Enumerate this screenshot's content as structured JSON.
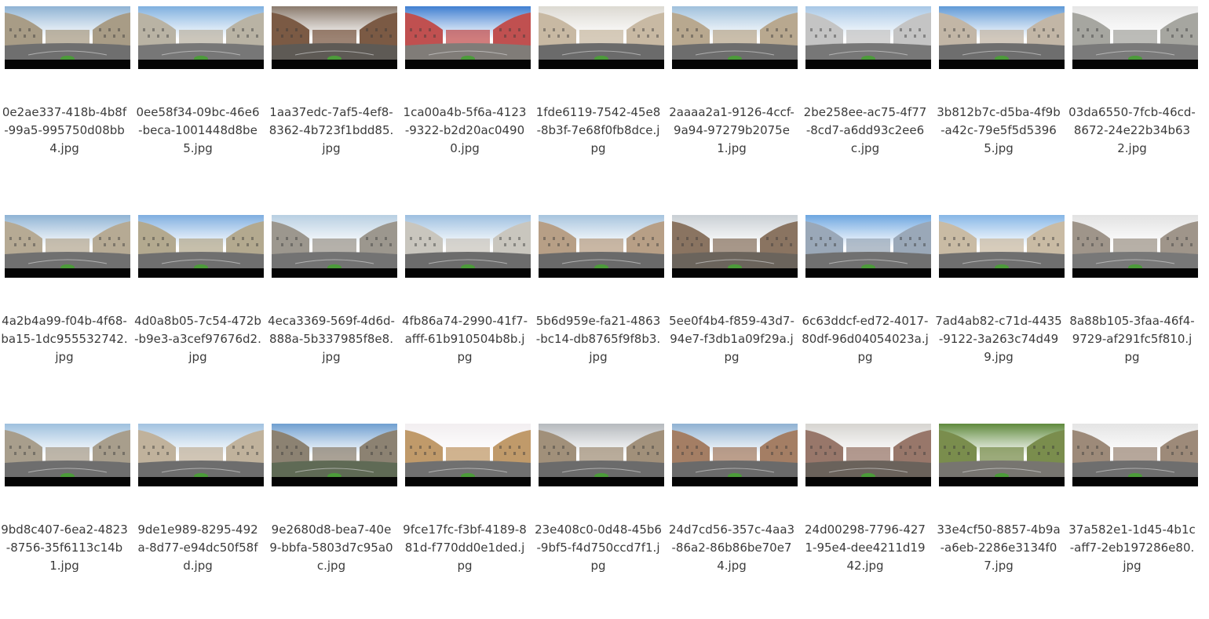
{
  "window": {
    "view": "icon-grid"
  },
  "icons": {
    "thumbnail": "panorama-image-thumbnail"
  },
  "files": [
    {
      "name": "0e2ae337-418b-4b8f-99a5-995750d08bb4.jpg",
      "sky": "#8fb3d4",
      "ground": "#6f6f6f",
      "building": "#a89c86"
    },
    {
      "name": "0ee58f34-09bc-46e6-beca-1001448d8be5.jpg",
      "sky": "#7fb0df",
      "ground": "#777777",
      "building": "#b9b3a4"
    },
    {
      "name": "1aa37edc-7af5-4ef8-8362-4b723f1bdd85.jpg",
      "sky": "#8a7a6c",
      "ground": "#5e5a55",
      "building": "#7b5a44"
    },
    {
      "name": "1ca00a4b-5f6a-4123-9322-b2d20ac04900.jpg",
      "sky": "#3f7fd1",
      "ground": "#807c78",
      "building": "#c05050"
    },
    {
      "name": "1fde6119-7542-45e8-8b3f-7e68f0fb8dce.jpg",
      "sky": "#dcd9d2",
      "ground": "#6b6b6b",
      "building": "#c8b9a3"
    },
    {
      "name": "2aaaa2a1-9126-4ccf-9a94-97279b2075e1.jpg",
      "sky": "#9fc0dc",
      "ground": "#6d6d6d",
      "building": "#b8a88f"
    },
    {
      "name": "2be258ee-ac75-4f77-8cd7-a6dd93c2ee6c.jpg",
      "sky": "#a7c7e6",
      "ground": "#777777",
      "building": "#c4c4c4"
    },
    {
      "name": "3b812b7c-d5ba-4f9b-a42c-79e5f5d53965.jpg",
      "sky": "#5f99d6",
      "ground": "#6e6e6e",
      "building": "#c2b6a6"
    },
    {
      "name": "03da6550-7fcb-46cd-8672-24e22b34b632.jpg",
      "sky": "#e6e6e6",
      "ground": "#7a7a7a",
      "building": "#a6a6a0"
    },
    {
      "name": "4a2b4a99-f04b-4f68-ba15-1dc955532742.jpg",
      "sky": "#8fb3d4",
      "ground": "#707070",
      "building": "#b6aa94"
    },
    {
      "name": "4d0a8b05-7c54-472b-b9e3-a3cef97676d2.jpg",
      "sky": "#7faee0",
      "ground": "#6f6f6f",
      "building": "#b3a98f"
    },
    {
      "name": "4eca3369-569f-4d6d-888a-5b337985f8e8.jpg",
      "sky": "#b8cfe2",
      "ground": "#737373",
      "building": "#9c978e"
    },
    {
      "name": "4fb86a74-2990-41f7-afff-61b910504b8b.jpg",
      "sky": "#9dbfe0",
      "ground": "#6c6c6c",
      "building": "#c9c6be"
    },
    {
      "name": "5b6d959e-fa21-4863-bc14-db8765f9f8b3.jpg",
      "sky": "#a7c4de",
      "ground": "#6a6a6a",
      "building": "#b79f86"
    },
    {
      "name": "5ee0f4b4-f859-43d7-94e7-f3db1a09f29a.jpg",
      "sky": "#c9cfd4",
      "ground": "#6b645c",
      "building": "#8a7461"
    },
    {
      "name": "6c63ddcf-ed72-4017-80df-96d04054023a.jpg",
      "sky": "#6da6e0",
      "ground": "#707070",
      "building": "#9aa8b8"
    },
    {
      "name": "7ad4ab82-c71d-4435-9122-3a263c74d499.jpg",
      "sky": "#86b6e6",
      "ground": "#6f6f6f",
      "building": "#c9bba4"
    },
    {
      "name": "8a88b105-3faa-46f4-9729-af291fc5f810.jpg",
      "sky": "#e2e2e2",
      "ground": "#787878",
      "building": "#9f958a"
    },
    {
      "name": "9bd8c407-6ea2-4823-8756-35f6113c14b1.jpg",
      "sky": "#9ec0de",
      "ground": "#6e6e6e",
      "building": "#a89e8c"
    },
    {
      "name": "9de1e989-8295-492a-8d77-e94dc50f58fd.jpg",
      "sky": "#a2c2e0",
      "ground": "#6d6d6d",
      "building": "#c0b29c"
    },
    {
      "name": "9e2680d8-bea7-40e9-bbfa-5803d7c95a0c.jpg",
      "sky": "#6f9fd0",
      "ground": "#5f6a55",
      "building": "#8c8272"
    },
    {
      "name": "9fce17fc-f3bf-4189-881d-f770dd0e1ded.jpg",
      "sky": "#f2eef0",
      "ground": "#707070",
      "building": "#c09a6a"
    },
    {
      "name": "23e408c0-0d48-45b6-9bf5-f4d750ccd7f1.jpg",
      "sky": "#b5b9bd",
      "ground": "#6b6b6b",
      "building": "#a1907a"
    },
    {
      "name": "24d7cd56-357c-4aa3-86a2-86b86be70e74.jpg",
      "sky": "#8fb1d2",
      "ground": "#6a6a6a",
      "building": "#a47e64"
    },
    {
      "name": "24d00298-7796-4271-95e4-dee4211d1942.jpg",
      "sky": "#d6d4d0",
      "ground": "#6a625b",
      "building": "#98776a"
    },
    {
      "name": "33e4cf50-8857-4b9a-a6eb-2286e3134f07.jpg",
      "sky": "#5f8a3c",
      "ground": "#777570",
      "building": "#7a8d4d"
    },
    {
      "name": "37a582e1-1d45-4b1c-aff7-2eb197286e80.jpg",
      "sky": "#e4e4e4",
      "ground": "#6e6e6e",
      "building": "#9d8a79"
    }
  ]
}
